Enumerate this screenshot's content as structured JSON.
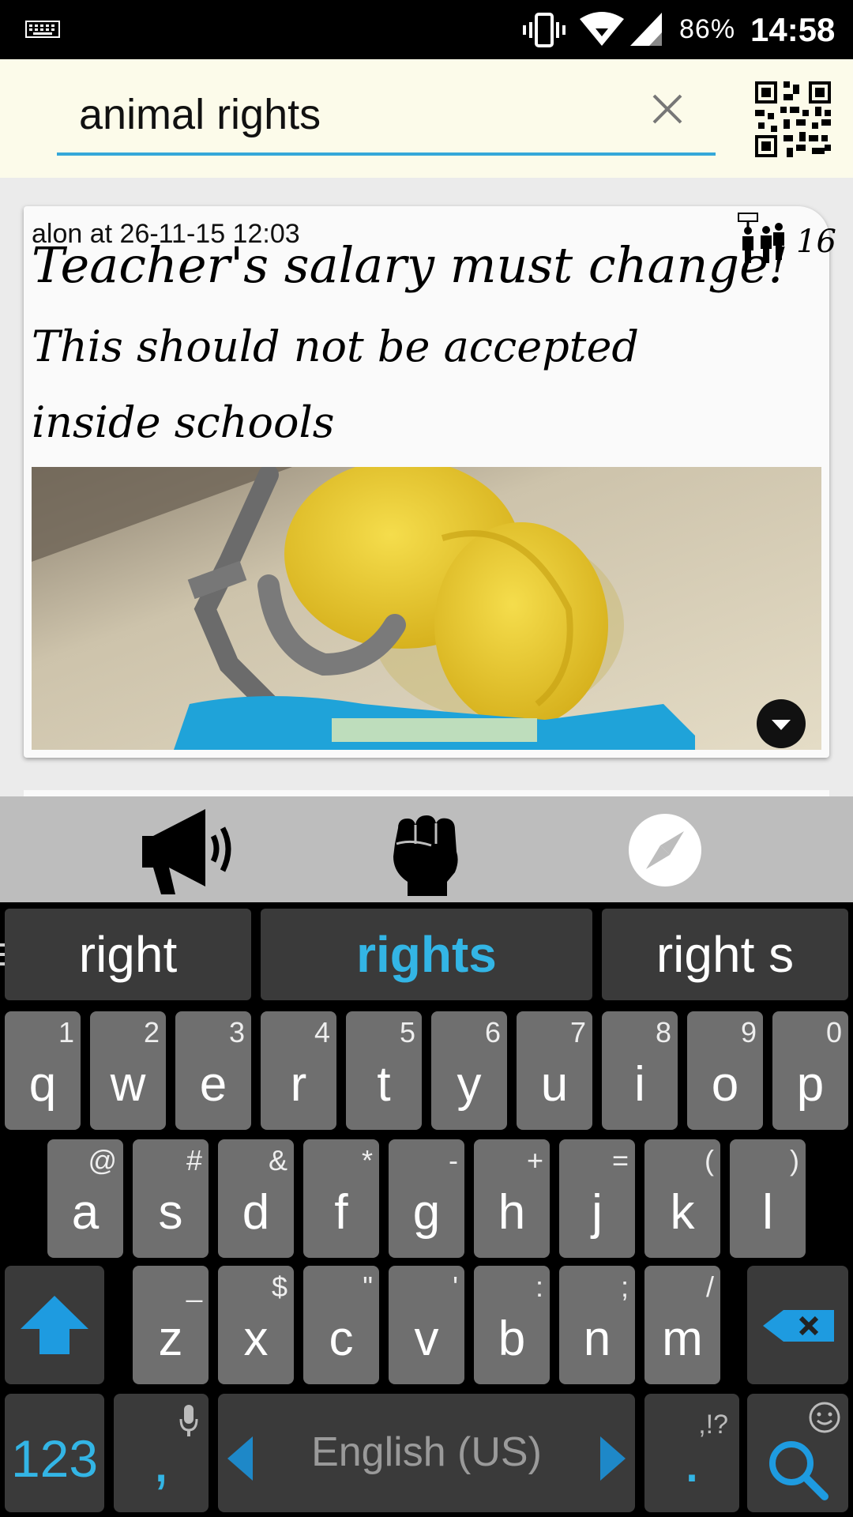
{
  "status_bar": {
    "battery": "86%",
    "time": "14:58",
    "icons": [
      "keyboard-icon",
      "vibrate-icon",
      "wifi-icon",
      "signal-icon"
    ]
  },
  "search": {
    "value": "animal rights",
    "clear_icon": "close-icon",
    "qr_icon": "qr-code-icon",
    "accent": "#35a8d9"
  },
  "card": {
    "meta": "alon at 26-11-15 12:03",
    "title": "Teacher's salary must change!",
    "body": "This should not be accepted inside schools",
    "supporters_count": "16",
    "supporters_icon": "protest-people-icon",
    "image": "photo",
    "expand_icon": "chevron-down-icon"
  },
  "action_bar": {
    "icons": [
      "megaphone-icon",
      "fist-icon",
      "compass-icon"
    ]
  },
  "keyboard": {
    "suggestions": [
      "right",
      "rights",
      "right s"
    ],
    "row1": [
      {
        "key": "q",
        "hint": "1"
      },
      {
        "key": "w",
        "hint": "2"
      },
      {
        "key": "e",
        "hint": "3"
      },
      {
        "key": "r",
        "hint": "4"
      },
      {
        "key": "t",
        "hint": "5"
      },
      {
        "key": "y",
        "hint": "6"
      },
      {
        "key": "u",
        "hint": "7"
      },
      {
        "key": "i",
        "hint": "8"
      },
      {
        "key": "o",
        "hint": "9"
      },
      {
        "key": "p",
        "hint": "0"
      }
    ],
    "row2": [
      {
        "key": "a",
        "hint": "@"
      },
      {
        "key": "s",
        "hint": "#"
      },
      {
        "key": "d",
        "hint": "&"
      },
      {
        "key": "f",
        "hint": "*"
      },
      {
        "key": "g",
        "hint": "-"
      },
      {
        "key": "h",
        "hint": "+"
      },
      {
        "key": "j",
        "hint": "="
      },
      {
        "key": "k",
        "hint": "("
      },
      {
        "key": "l",
        "hint": ")"
      }
    ],
    "row3": [
      {
        "key": "z",
        "hint": "_"
      },
      {
        "key": "x",
        "hint": "$"
      },
      {
        "key": "c",
        "hint": "\""
      },
      {
        "key": "v",
        "hint": "'"
      },
      {
        "key": "b",
        "hint": ":"
      },
      {
        "key": "n",
        "hint": ";"
      },
      {
        "key": "m",
        "hint": "/"
      }
    ],
    "symbols_key": "123",
    "comma_key": ",",
    "space_label": "English (US)",
    "period_key": ".",
    "period_hint": ",!?",
    "accent": "#33b5e5"
  }
}
